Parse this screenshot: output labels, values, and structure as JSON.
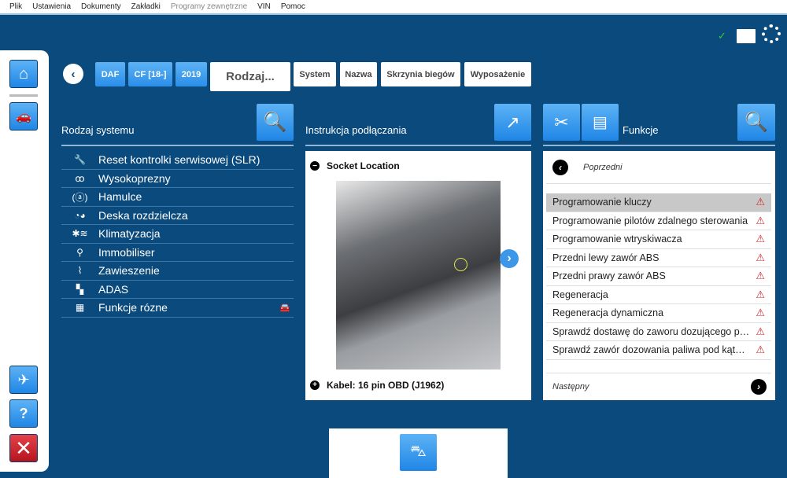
{
  "menu": [
    "Plik",
    "Ustawienia",
    "Dokumenty",
    "Zakładki",
    "Programy zewnętrzne",
    "VIN",
    "Pomoc"
  ],
  "status": {
    "check": "✓",
    "battery": "battery-icon",
    "spinner": "loading-icon"
  },
  "breadcrumb": {
    "make": "DAF",
    "model": "CF [18-]",
    "year": "2019",
    "current": "Rodzaj...",
    "system": "System",
    "name": "Nazwa",
    "gearbox": "Skrzynia biegów",
    "equipment": "Wyposażenie"
  },
  "systems": {
    "title": "Rodzaj systemu",
    "items": [
      {
        "label": "Reset kontrolki serwisowej (SLR)",
        "icon": "wrench-icon"
      },
      {
        "label": "Wysokoprezny",
        "icon": "glow-plug-icon"
      },
      {
        "label": "Hamulce",
        "icon": "abs-icon"
      },
      {
        "label": "Deska rozdzielcza",
        "icon": "dashboard-icon"
      },
      {
        "label": "Klimatyzacja",
        "icon": "climate-icon"
      },
      {
        "label": "Immobiliser",
        "icon": "key-icon"
      },
      {
        "label": "Zawieszenie",
        "icon": "suspension-icon"
      },
      {
        "label": "ADAS",
        "icon": "adas-icon"
      },
      {
        "label": "Funkcje rózne",
        "icon": "network-icon"
      }
    ]
  },
  "connection": {
    "title": "Instrukcja podłączania",
    "socket": "Socket Location",
    "cable": "Kabel: 16 pin OBD (J1962)"
  },
  "functions": {
    "title": "Funkcje",
    "prev": "Poprzedni",
    "next": "Następny",
    "items": [
      "Programowanie kluczy",
      "Programowanie pilotów zdalnego sterowania",
      "Programowanie wtryskiwacza",
      "Przedni lewy zawór ABS",
      "Przedni prawy zawór ABS",
      "Regeneracja",
      "Regeneracja dynamiczna",
      "Sprawdź dostawę do zaworu dozującego p…",
      "Sprawdź zawór dozowania paliwa pod kąt…"
    ],
    "selected": 0
  },
  "colors": {
    "background": "#0b4a7c",
    "accent": "#2a8ee8",
    "warning": "#d0262b"
  }
}
